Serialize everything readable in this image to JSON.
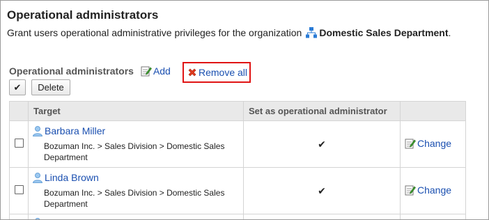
{
  "page": {
    "title": "Operational administrators",
    "description_prefix": "Grant users operational administrative privileges for the organization",
    "org_name": "Domestic Sales Department",
    "description_suffix": "."
  },
  "section": {
    "label": "Operational administrators",
    "add_label": "Add",
    "remove_all_label": "Remove all"
  },
  "toolbar": {
    "check_all_glyph": "✔",
    "delete_label": "Delete"
  },
  "table": {
    "headers": {
      "target": "Target",
      "set_as_admin": "Set as operational administrator"
    },
    "rows": [
      {
        "name": "Barbara Miller",
        "path": "Bozuman Inc. > Sales Division > Domestic Sales Department",
        "set_mark": "✔",
        "change_label": "Change"
      },
      {
        "name": "Linda Brown",
        "path": "Bozuman Inc. > Sales Division > Domestic Sales Department",
        "set_mark": "✔",
        "change_label": "Change"
      }
    ]
  },
  "colors": {
    "link": "#1a4fb0",
    "highlight_box": "#e01414",
    "header_bg": "#e9e9e9"
  },
  "icons": {
    "org": "org-chart-icon",
    "add": "edit-add-icon",
    "remove_all": "red-x-icon",
    "user": "user-icon",
    "change": "edit-icon"
  }
}
